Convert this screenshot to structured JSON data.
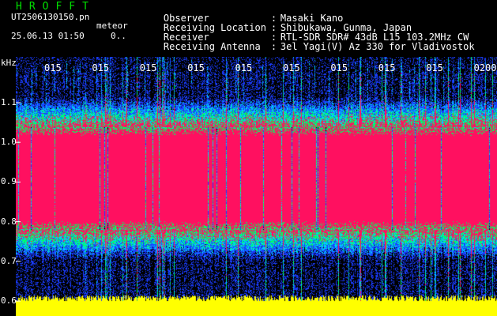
{
  "app": {
    "name": "HROFFT"
  },
  "file": {
    "filename": "UT2506130150.pn",
    "mode": "meteor",
    "datetime": "25.06.13 01:50",
    "counter": "0.."
  },
  "station": [
    {
      "label": "Observer",
      "value": "Masaki Kano"
    },
    {
      "label": "Receiving Location",
      "value": "Shibukawa, Gunma, Japan"
    },
    {
      "label": "Receiver",
      "value": "RTL-SDR SDR# 43dB L15 103.2MHz CW"
    },
    {
      "label": "Receiving Antenna",
      "value": "3el Yagi(V) Az 330 for Vladivostok"
    }
  ],
  "chart_data": {
    "type": "heatmap",
    "title": "",
    "xlabel": "",
    "ylabel": "kHz",
    "y_ticks": [
      "1.1",
      "1.0",
      "0.9",
      "0.8",
      "0.7",
      "0.6"
    ],
    "x_ticks": [
      "015",
      "015",
      "015",
      "015",
      "015",
      "015",
      "015",
      "015",
      "015",
      "0200"
    ],
    "signal_band_khz": [
      0.78,
      1.04
    ],
    "noise_floor_band_khz": [
      0.55,
      0.61
    ],
    "colors": {
      "background": "#000000",
      "noise": "#1a3cff",
      "weak": "#00d0ff",
      "medium": "#00ff60",
      "strong": "#ff1060",
      "floor": "#ffff00"
    }
  }
}
